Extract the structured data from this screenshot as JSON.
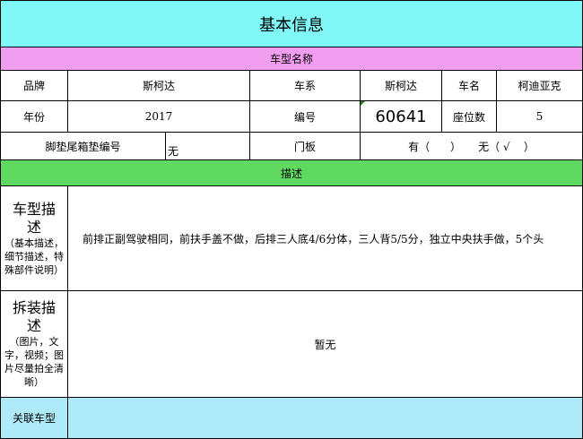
{
  "title": "基本信息",
  "section_car": "车型名称",
  "row1": {
    "brand_label": "品牌",
    "brand_value": "斯柯达",
    "series_label": "车系",
    "series_value": "斯柯达",
    "name_label": "车名",
    "name_value": "柯迪亚克"
  },
  "row2": {
    "year_label": "年份",
    "year_value": "2017",
    "code_label": "编号",
    "code_value": "60641",
    "seats_label": "座位数",
    "seats_value": "5"
  },
  "row3": {
    "mat_label": "脚垫尾箱垫编号",
    "mat_value": "无",
    "door_label": "门板",
    "door_options": "有（      ）     无（ √    ）"
  },
  "section_desc": "描述",
  "model_desc": {
    "heading": "车型描述",
    "hint": "（基本描述，细节描述，特殊部件说明）",
    "text": "前排正副驾驶相同，前扶手盖不做，后排三人底4/6分体，三人背5/5分，独立中央扶手做，5个头"
  },
  "install_desc": {
    "heading": "拆装描述",
    "hint": "（图片，文字，视频；图片尽量拍全清晰）",
    "text": "暂无"
  },
  "related": {
    "label": "关联车型",
    "value": ""
  },
  "colors": {
    "title_bg": "#80f8f8",
    "section_car_bg": "#f19ef0",
    "section_desc_bg": "#5fd95f",
    "related_bg": "#aeeaf8"
  }
}
